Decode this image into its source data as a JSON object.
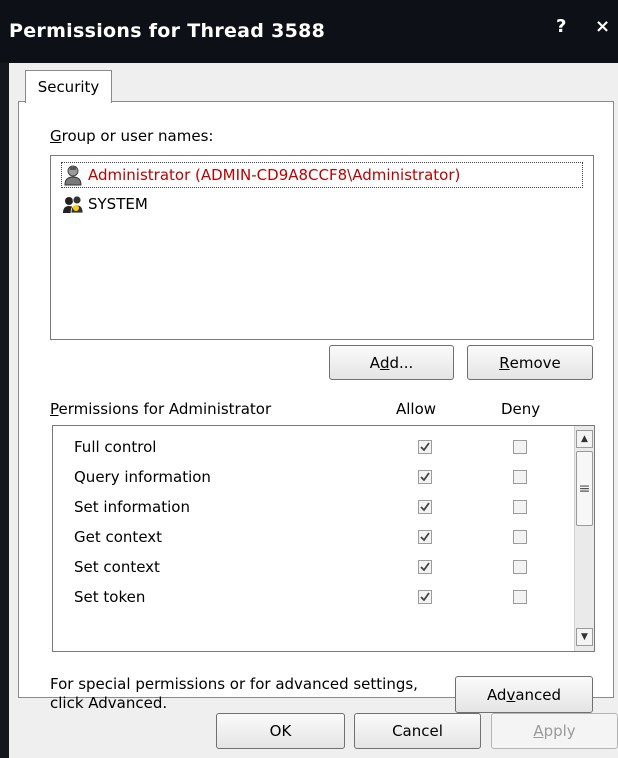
{
  "window": {
    "title": "Permissions for Thread 3588",
    "help_glyph": "?",
    "close_glyph": "×"
  },
  "tabs": [
    {
      "label": "Security",
      "selected": true
    }
  ],
  "group_section": {
    "label_prefix": "",
    "label_accel": "G",
    "label_rest": "roup or user names:"
  },
  "users": [
    {
      "name": "Administrator (ADMIN-CD9A8CCF8\\Administrator)",
      "selected": true,
      "icon": "single-user-icon",
      "color": "#c00000"
    },
    {
      "name": "SYSTEM",
      "selected": false,
      "icon": "user-group-icon",
      "color": "#000000"
    }
  ],
  "buttons": {
    "add": {
      "pre": "A",
      "accel": "d",
      "post": "d..."
    },
    "remove": {
      "pre": "",
      "accel": "R",
      "post": "emove"
    },
    "advanced": {
      "pre": "Ad",
      "accel": "v",
      "post": "anced"
    },
    "ok": "OK",
    "cancel": "Cancel",
    "apply": {
      "pre": "",
      "accel": "A",
      "post": "pply",
      "disabled": true
    }
  },
  "permissions_section": {
    "label_accel": "P",
    "label_rest": "ermissions for Administrator",
    "allow_header": "Allow",
    "deny_header": "Deny"
  },
  "permissions": [
    {
      "name": "Full control",
      "allow": true,
      "deny": false
    },
    {
      "name": "Query information",
      "allow": true,
      "deny": false
    },
    {
      "name": "Set information",
      "allow": true,
      "deny": false
    },
    {
      "name": "Get context",
      "allow": true,
      "deny": false
    },
    {
      "name": "Set context",
      "allow": true,
      "deny": false
    },
    {
      "name": "Set token",
      "allow": true,
      "deny": false
    }
  ],
  "advanced_note": {
    "line1": "For special permissions or for advanced settings,",
    "line2": "click Advanced."
  },
  "colors": {
    "titlebar": "#0d1117",
    "client": "#efefef",
    "selected_text": "#c00000"
  }
}
